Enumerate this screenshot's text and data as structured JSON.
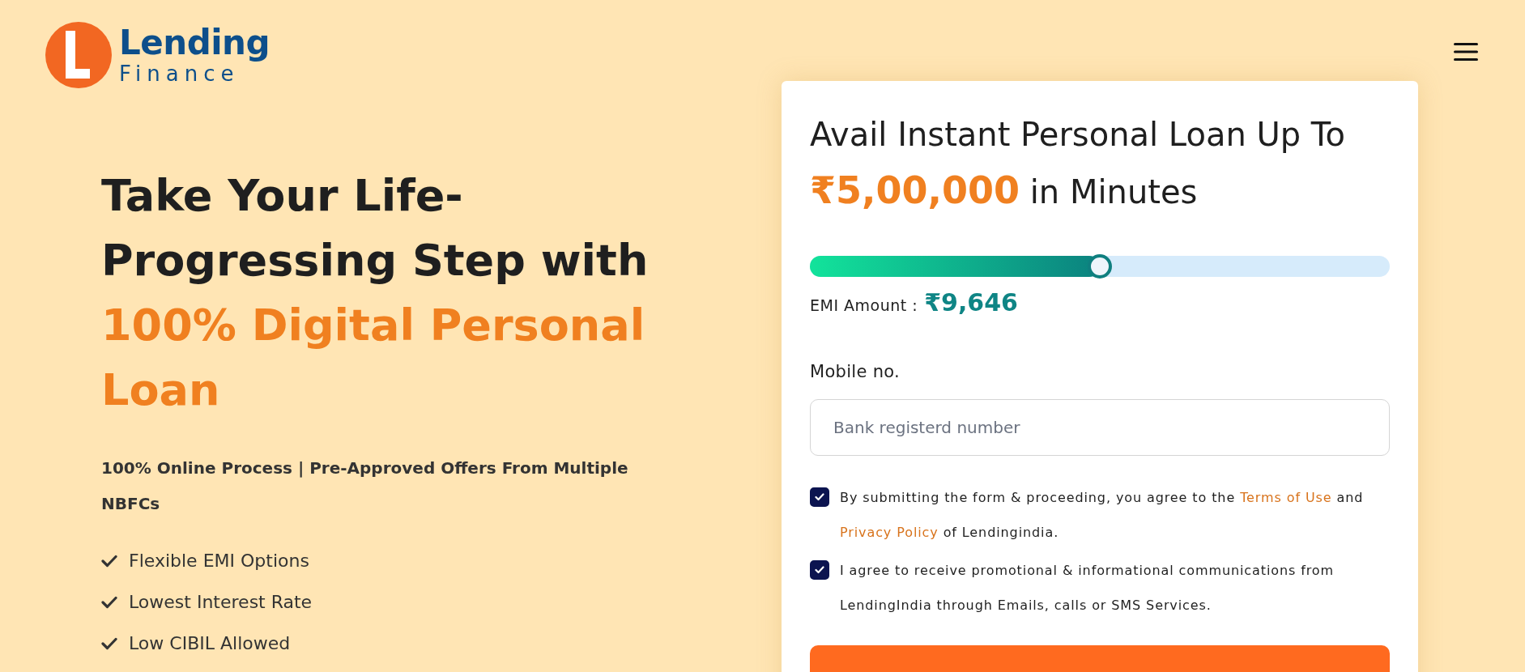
{
  "logo": {
    "word_top": "Lending",
    "word_bottom": "Finance"
  },
  "hero": {
    "title": "Take Your Life-Progressing Step with",
    "title_highlight": "100% Digital Personal Loan",
    "subtitle": "100% Online Process | Pre-Approved Offers From Multiple NBFCs",
    "features": [
      "Flexible EMI Options",
      "Lowest Interest Rate",
      "Low CIBIL Allowed"
    ]
  },
  "card": {
    "heading_start": "Avail Instant Personal Loan Up To",
    "heading_amount": "₹5,00,000",
    "heading_end": "in Minutes",
    "loan_slider": {
      "level": 0.5
    },
    "emi_label": "EMI Amount :",
    "emi_value": "₹9,646",
    "mobile": {
      "label": "Mobile no.",
      "placeholder": "Bank registerd number"
    },
    "consents": [
      {
        "checked": true,
        "segments": [
          {
            "kind": "text",
            "text": "By submitting the form & proceeding, you agree to the "
          },
          {
            "kind": "link",
            "text": "Terms of Use"
          },
          {
            "kind": "text",
            "text": " and "
          },
          {
            "kind": "link",
            "text": "Privacy Policy"
          },
          {
            "kind": "text",
            "text": " of Lendingindia."
          }
        ]
      },
      {
        "checked": true,
        "segments": [
          {
            "kind": "text",
            "text": "I agree to receive promotional & informational communications from LendingIndia through Emails, calls or SMS Services."
          }
        ]
      }
    ]
  }
}
